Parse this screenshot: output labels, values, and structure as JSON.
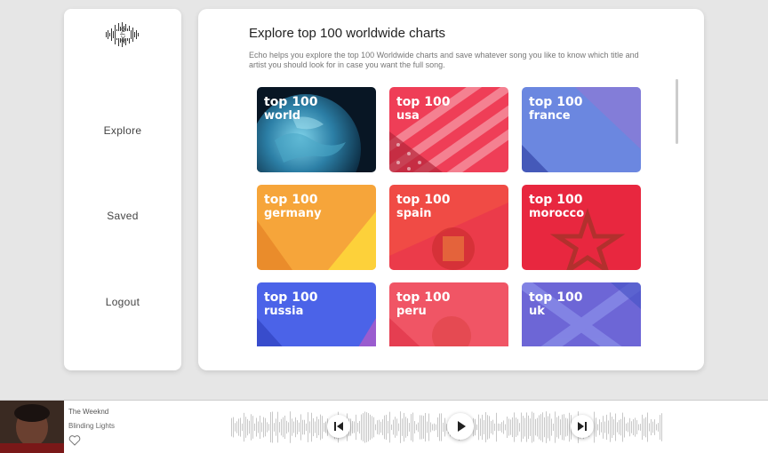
{
  "sidebar": {
    "logo_text": "echo",
    "items": [
      {
        "label": "Explore"
      },
      {
        "label": "Saved"
      },
      {
        "label": "Logout"
      }
    ]
  },
  "main": {
    "title": "Explore top 100 worldwide charts",
    "description": "Echo helps you explore the top 100 Worldwide charts and save whatever song you like to know which title and artist you should look for in case you want the full song.",
    "cards": [
      {
        "line1": "top 100",
        "line2": "world"
      },
      {
        "line1": "top 100",
        "line2": "usa"
      },
      {
        "line1": "top 100",
        "line2": "france"
      },
      {
        "line1": "top 100",
        "line2": "germany"
      },
      {
        "line1": "top 100",
        "line2": "spain"
      },
      {
        "line1": "top 100",
        "line2": "morocco"
      },
      {
        "line1": "top 100",
        "line2": "russia"
      },
      {
        "line1": "top 100",
        "line2": "peru"
      },
      {
        "line1": "top 100",
        "line2": "uk"
      }
    ]
  },
  "player": {
    "artist": "The Weeknd",
    "song": "Blinding Lights",
    "icons": [
      "heart-icon",
      "previous-icon",
      "play-icon",
      "next-icon"
    ]
  },
  "colors": {
    "world": "#0c2236",
    "usa": "#e8344e",
    "france": "#6a7fdc",
    "germany": "#f4a62a",
    "spain": "#ee3d3d",
    "morocco": "#e5243b",
    "russia": "#4a5de6",
    "peru": "#f0505c",
    "uk": "#7064d8"
  }
}
